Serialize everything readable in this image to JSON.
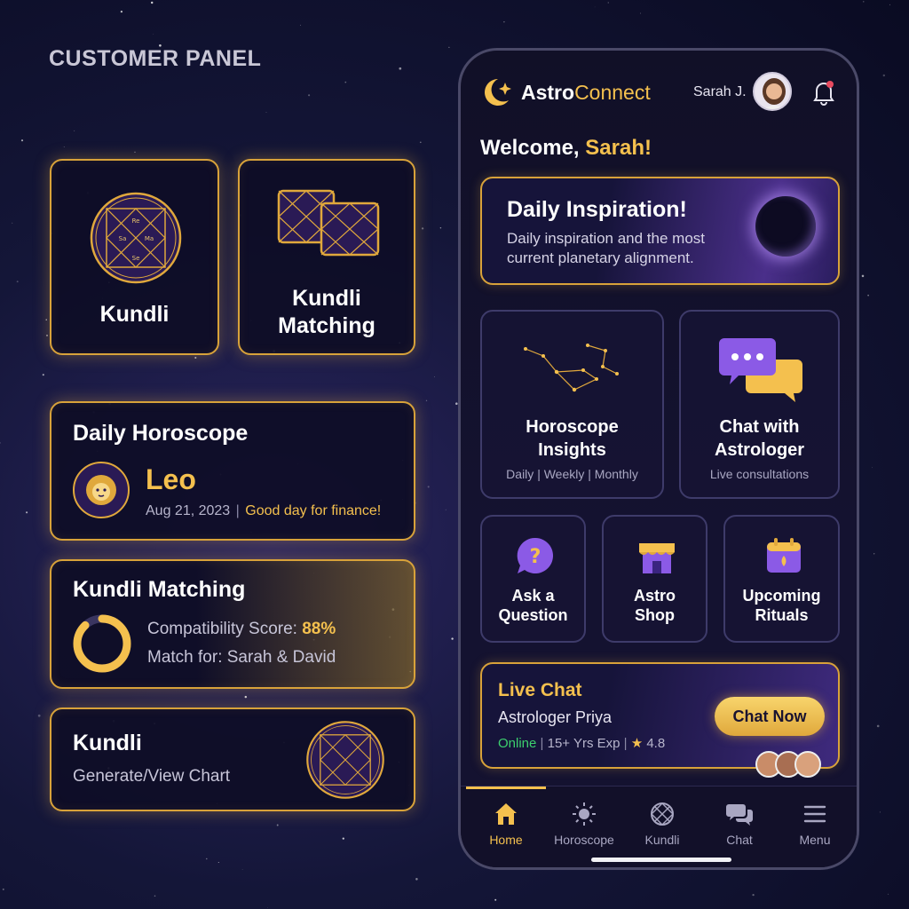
{
  "panel_title": "CUSTOMER PANEL",
  "left": {
    "tile_kundli": {
      "label": "Kundli"
    },
    "tile_matching": {
      "line1": "Kundli",
      "line2": "Matching"
    },
    "daily_horoscope": {
      "title": "Daily Horoscope",
      "sign": "Leo",
      "date": "Aug 21, 2023",
      "separator": "|",
      "message": "Good day for finance!"
    },
    "kundli_matching": {
      "title": "Kundli Matching",
      "score_label": "Compatibility Score:",
      "score_value": "88%",
      "score_fraction": 0.88,
      "match_for": "Match for: Sarah & David"
    },
    "kundli": {
      "title": "Kundli",
      "subtitle": "Generate/View Chart"
    }
  },
  "phone": {
    "brand_part1": "Astro",
    "brand_part2": "Connect",
    "user_name": "Sarah J.",
    "welcome_prefix": "Welcome,",
    "welcome_name": "Sarah!",
    "inspiration": {
      "title": "Daily Inspiration!",
      "line1": "Daily inspiration and the most",
      "line2": "current planetary alignment."
    },
    "horoscope_insights": {
      "line1": "Horoscope",
      "line2": "Insights",
      "sub_daily": "Daily",
      "sub_weekly": "Weekly",
      "sub_monthly": "Monthly",
      "sep": "|"
    },
    "chat_astrologer": {
      "line1": "Chat with",
      "line2": "Astrologer",
      "sub": "Live consultations"
    },
    "ask_question": {
      "line1": "Ask a",
      "line2": "Question"
    },
    "astro_shop": {
      "line1": "Astro",
      "line2": "Shop"
    },
    "rituals": {
      "line1": "Upcoming",
      "line2": "Rituals"
    },
    "live_chat": {
      "title": "Live Chat",
      "name": "Astrologer Priya",
      "status": "Online",
      "sep": "|",
      "experience": "15+ Yrs Exp",
      "rating": "4.8",
      "button": "Chat Now"
    },
    "nav": {
      "home": "Home",
      "horoscope": "Horoscope",
      "kundli": "Kundli",
      "chat": "Chat",
      "menu": "Menu"
    }
  },
  "colors": {
    "accent_gold": "#f4c04e",
    "purple": "#7a4fd0",
    "online_green": "#3ccf6e",
    "notification_red": "#e84a5f"
  }
}
